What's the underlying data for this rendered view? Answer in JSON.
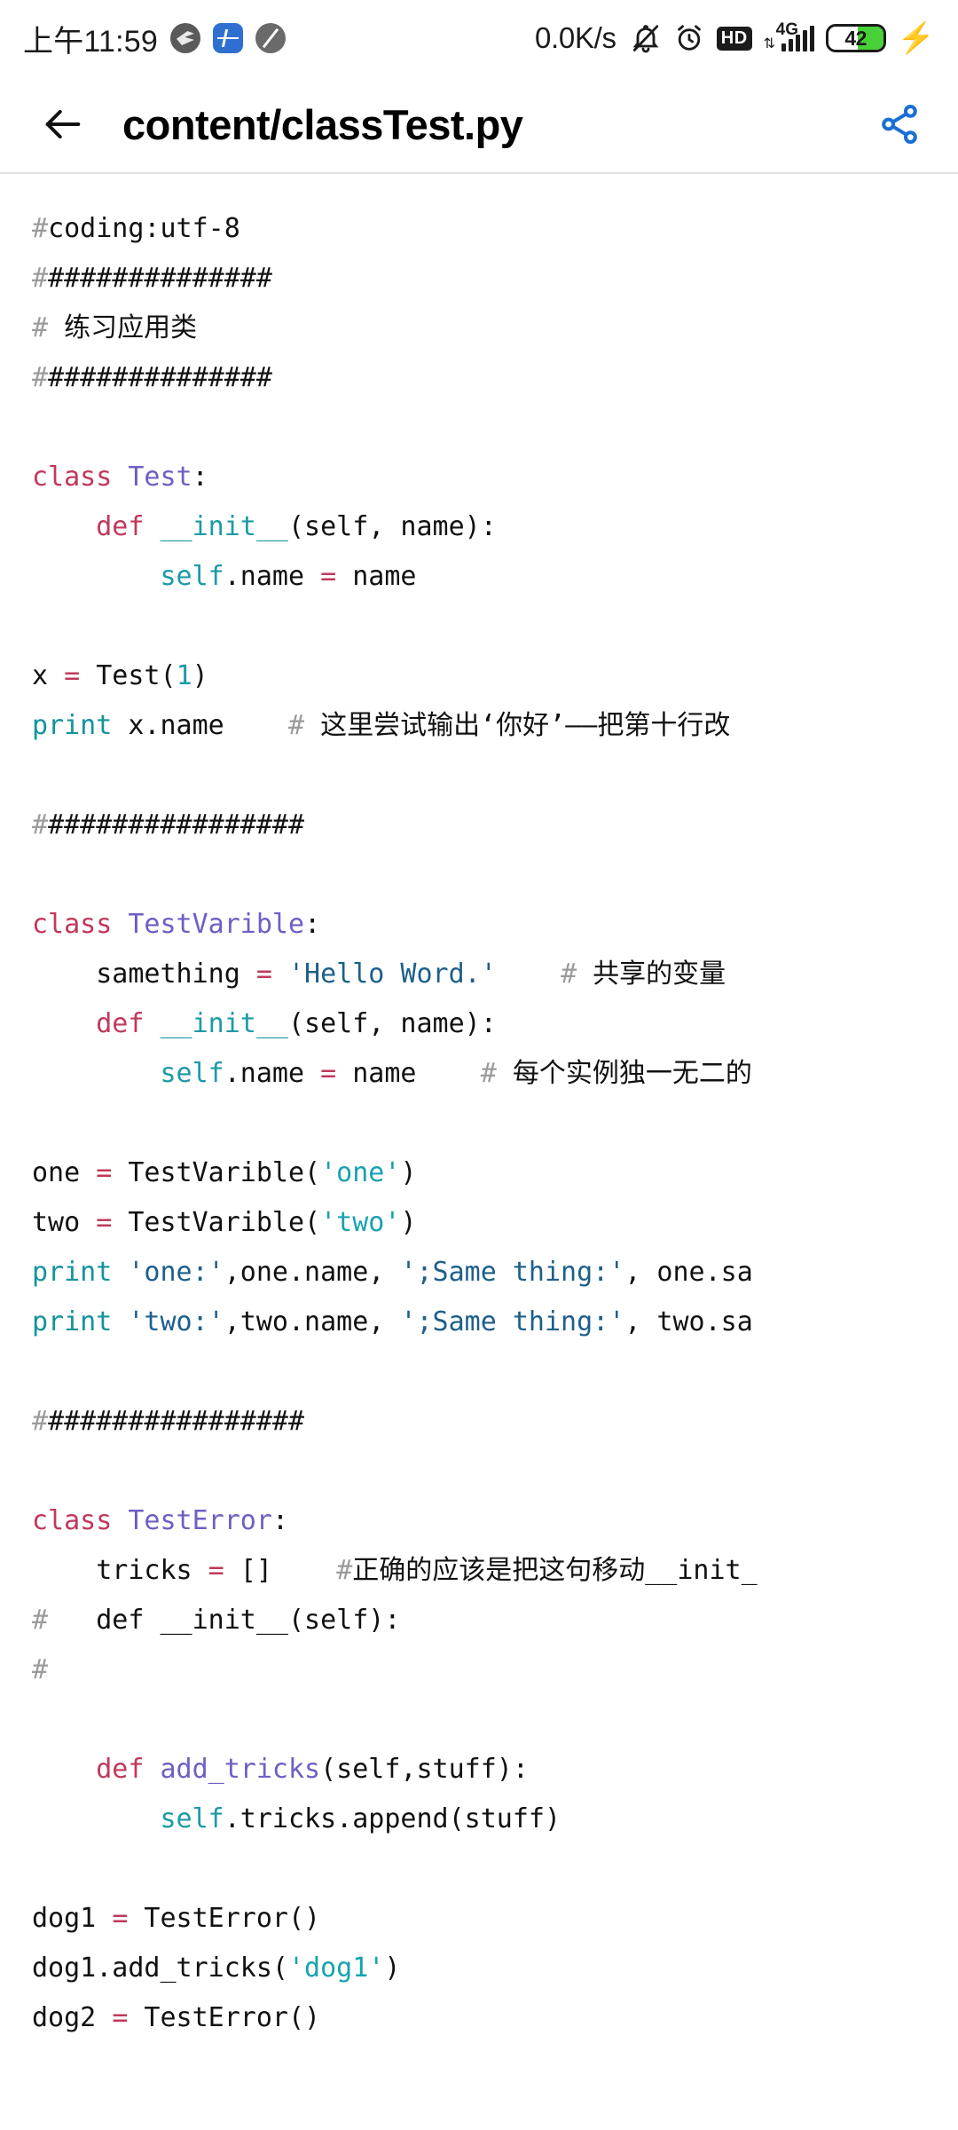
{
  "status_bar": {
    "clock": "上午11:59",
    "network_speed": "0.0K/s",
    "hd_label": "HD",
    "network_type": "4G",
    "battery_level": "42",
    "charging": true,
    "icons": [
      "app-wing-icon",
      "app-pulse-icon",
      "app-muted-icon",
      "bell-off-icon",
      "alarm-icon",
      "hd-icon",
      "signal-bars-icon",
      "battery-icon",
      "charging-bolt-icon"
    ],
    "colors": {
      "battery_fill": "#47d038",
      "text": "#1b1b1b"
    }
  },
  "app_bar": {
    "back_label": "←",
    "title": "content/classTest.py",
    "share_label": "share",
    "share_color": "#1a6fd4"
  },
  "editor": {
    "language": "python",
    "colors": {
      "keyword": "#c0395a",
      "class_name": "#6f5ec4",
      "builtin": "#13939c",
      "self": "#1d9aa6",
      "string_navy": "#1d5f8a",
      "string_teal": "#17a2b0",
      "number": "#1d9aa6",
      "comment_hash": "#9b9b9b",
      "comment_text": "#111111",
      "background": "#ffffff",
      "foreground": "#111111"
    },
    "lines": [
      {
        "i": 1,
        "tokens": [
          {
            "t": "#",
            "c": "cm"
          },
          {
            "t": "coding:utf-8",
            "c": ""
          }
        ]
      },
      {
        "i": 2,
        "tokens": [
          {
            "t": "#",
            "c": "cm"
          },
          {
            "t": "##############",
            "c": ""
          }
        ]
      },
      {
        "i": 3,
        "tokens": [
          {
            "t": "#",
            "c": "cm"
          },
          {
            "t": " 练习应用类",
            "c": "cmt"
          }
        ]
      },
      {
        "i": 4,
        "tokens": [
          {
            "t": "#",
            "c": "cm"
          },
          {
            "t": "##############",
            "c": ""
          }
        ]
      },
      {
        "i": 5,
        "tokens": []
      },
      {
        "i": 6,
        "tokens": [
          {
            "t": "class",
            "c": "k"
          },
          {
            "t": " ",
            "c": ""
          },
          {
            "t": "Test",
            "c": "cn"
          },
          {
            "t": ":",
            "c": ""
          }
        ]
      },
      {
        "i": 7,
        "tokens": [
          {
            "t": "    ",
            "c": ""
          },
          {
            "t": "def",
            "c": "k"
          },
          {
            "t": " ",
            "c": ""
          },
          {
            "t": "__init__",
            "c": "fn"
          },
          {
            "t": "(self, name):",
            "c": ""
          }
        ]
      },
      {
        "i": 8,
        "tokens": [
          {
            "t": "        ",
            "c": ""
          },
          {
            "t": "self",
            "c": "sf"
          },
          {
            "t": ".name ",
            "c": ""
          },
          {
            "t": "=",
            "c": "k"
          },
          {
            "t": " name",
            "c": ""
          }
        ]
      },
      {
        "i": 9,
        "tokens": []
      },
      {
        "i": 10,
        "tokens": [
          {
            "t": "x ",
            "c": ""
          },
          {
            "t": "=",
            "c": "k"
          },
          {
            "t": " Test(",
            "c": ""
          },
          {
            "t": "1",
            "c": "nu"
          },
          {
            "t": ")",
            "c": ""
          }
        ]
      },
      {
        "i": 11,
        "tokens": [
          {
            "t": "print",
            "c": "bi"
          },
          {
            "t": " x.name    ",
            "c": ""
          },
          {
            "t": "#",
            "c": "cm"
          },
          {
            "t": " 这里尝试输出‘你好’——把第十行改",
            "c": "cmt"
          }
        ]
      },
      {
        "i": 12,
        "tokens": []
      },
      {
        "i": 13,
        "tokens": [
          {
            "t": "#",
            "c": "cm"
          },
          {
            "t": "################",
            "c": ""
          }
        ]
      },
      {
        "i": 14,
        "tokens": []
      },
      {
        "i": 15,
        "tokens": [
          {
            "t": "class",
            "c": "k"
          },
          {
            "t": " ",
            "c": ""
          },
          {
            "t": "TestVarible",
            "c": "cn"
          },
          {
            "t": ":",
            "c": ""
          }
        ]
      },
      {
        "i": 16,
        "tokens": [
          {
            "t": "    samething ",
            "c": ""
          },
          {
            "t": "=",
            "c": "k"
          },
          {
            "t": " ",
            "c": ""
          },
          {
            "t": "'Hello Word.'",
            "c": "st"
          },
          {
            "t": "    ",
            "c": ""
          },
          {
            "t": "#",
            "c": "cm"
          },
          {
            "t": " 共享的变量",
            "c": "cmt"
          }
        ]
      },
      {
        "i": 17,
        "tokens": [
          {
            "t": "    ",
            "c": ""
          },
          {
            "t": "def",
            "c": "k"
          },
          {
            "t": " ",
            "c": ""
          },
          {
            "t": "__init__",
            "c": "fn"
          },
          {
            "t": "(self, name):",
            "c": ""
          }
        ]
      },
      {
        "i": 18,
        "tokens": [
          {
            "t": "        ",
            "c": ""
          },
          {
            "t": "self",
            "c": "sf"
          },
          {
            "t": ".name ",
            "c": ""
          },
          {
            "t": "=",
            "c": "k"
          },
          {
            "t": " name    ",
            "c": ""
          },
          {
            "t": "#",
            "c": "cm"
          },
          {
            "t": " 每个实例独一无二的",
            "c": "cmt"
          }
        ]
      },
      {
        "i": 19,
        "tokens": []
      },
      {
        "i": 20,
        "tokens": [
          {
            "t": "one ",
            "c": ""
          },
          {
            "t": "=",
            "c": "k"
          },
          {
            "t": " TestVarible(",
            "c": ""
          },
          {
            "t": "'one'",
            "c": "st2"
          },
          {
            "t": ")",
            "c": ""
          }
        ]
      },
      {
        "i": 21,
        "tokens": [
          {
            "t": "two ",
            "c": ""
          },
          {
            "t": "=",
            "c": "k"
          },
          {
            "t": " TestVarible(",
            "c": ""
          },
          {
            "t": "'two'",
            "c": "st2"
          },
          {
            "t": ")",
            "c": ""
          }
        ]
      },
      {
        "i": 22,
        "tokens": [
          {
            "t": "print",
            "c": "bi"
          },
          {
            "t": " ",
            "c": ""
          },
          {
            "t": "'one:'",
            "c": "st"
          },
          {
            "t": ",one.name, ",
            "c": ""
          },
          {
            "t": "';Same thing:'",
            "c": "st"
          },
          {
            "t": ", one.sa",
            "c": ""
          }
        ]
      },
      {
        "i": 23,
        "tokens": [
          {
            "t": "print",
            "c": "bi"
          },
          {
            "t": " ",
            "c": ""
          },
          {
            "t": "'two:'",
            "c": "st"
          },
          {
            "t": ",two.name, ",
            "c": ""
          },
          {
            "t": "';Same thing:'",
            "c": "st"
          },
          {
            "t": ", two.sa",
            "c": ""
          }
        ]
      },
      {
        "i": 24,
        "tokens": []
      },
      {
        "i": 25,
        "tokens": [
          {
            "t": "#",
            "c": "cm"
          },
          {
            "t": "################",
            "c": ""
          }
        ]
      },
      {
        "i": 26,
        "tokens": []
      },
      {
        "i": 27,
        "tokens": [
          {
            "t": "class",
            "c": "k"
          },
          {
            "t": " ",
            "c": ""
          },
          {
            "t": "TestError",
            "c": "cn"
          },
          {
            "t": ":",
            "c": ""
          }
        ]
      },
      {
        "i": 28,
        "tokens": [
          {
            "t": "    tricks ",
            "c": ""
          },
          {
            "t": "=",
            "c": "k"
          },
          {
            "t": " []    ",
            "c": ""
          },
          {
            "t": "#",
            "c": "cm"
          },
          {
            "t": "正确的应该是把这句移动__init_",
            "c": "cmt"
          }
        ]
      },
      {
        "i": 29,
        "tokens": [
          {
            "t": "#",
            "c": "cm"
          },
          {
            "t": "   def __init__(self):",
            "c": "cmt"
          }
        ]
      },
      {
        "i": 30,
        "tokens": [
          {
            "t": "#",
            "c": "cm"
          }
        ]
      },
      {
        "i": 31,
        "tokens": []
      },
      {
        "i": 32,
        "tokens": [
          {
            "t": "    ",
            "c": ""
          },
          {
            "t": "def",
            "c": "k"
          },
          {
            "t": " ",
            "c": ""
          },
          {
            "t": "add_tricks",
            "c": "cn"
          },
          {
            "t": "(self,stuff):",
            "c": ""
          }
        ]
      },
      {
        "i": 33,
        "tokens": [
          {
            "t": "        ",
            "c": ""
          },
          {
            "t": "self",
            "c": "sf"
          },
          {
            "t": ".tricks.append(stuff)",
            "c": ""
          }
        ]
      },
      {
        "i": 34,
        "tokens": []
      },
      {
        "i": 35,
        "tokens": [
          {
            "t": "dog1 ",
            "c": ""
          },
          {
            "t": "=",
            "c": "k"
          },
          {
            "t": " TestError()",
            "c": ""
          }
        ]
      },
      {
        "i": 36,
        "tokens": [
          {
            "t": "dog1.add_tricks(",
            "c": ""
          },
          {
            "t": "'dog1'",
            "c": "st2"
          },
          {
            "t": ")",
            "c": ""
          }
        ]
      },
      {
        "i": 37,
        "tokens": [
          {
            "t": "dog2 ",
            "c": ""
          },
          {
            "t": "=",
            "c": "k"
          },
          {
            "t": " TestError()",
            "c": ""
          }
        ]
      }
    ]
  }
}
